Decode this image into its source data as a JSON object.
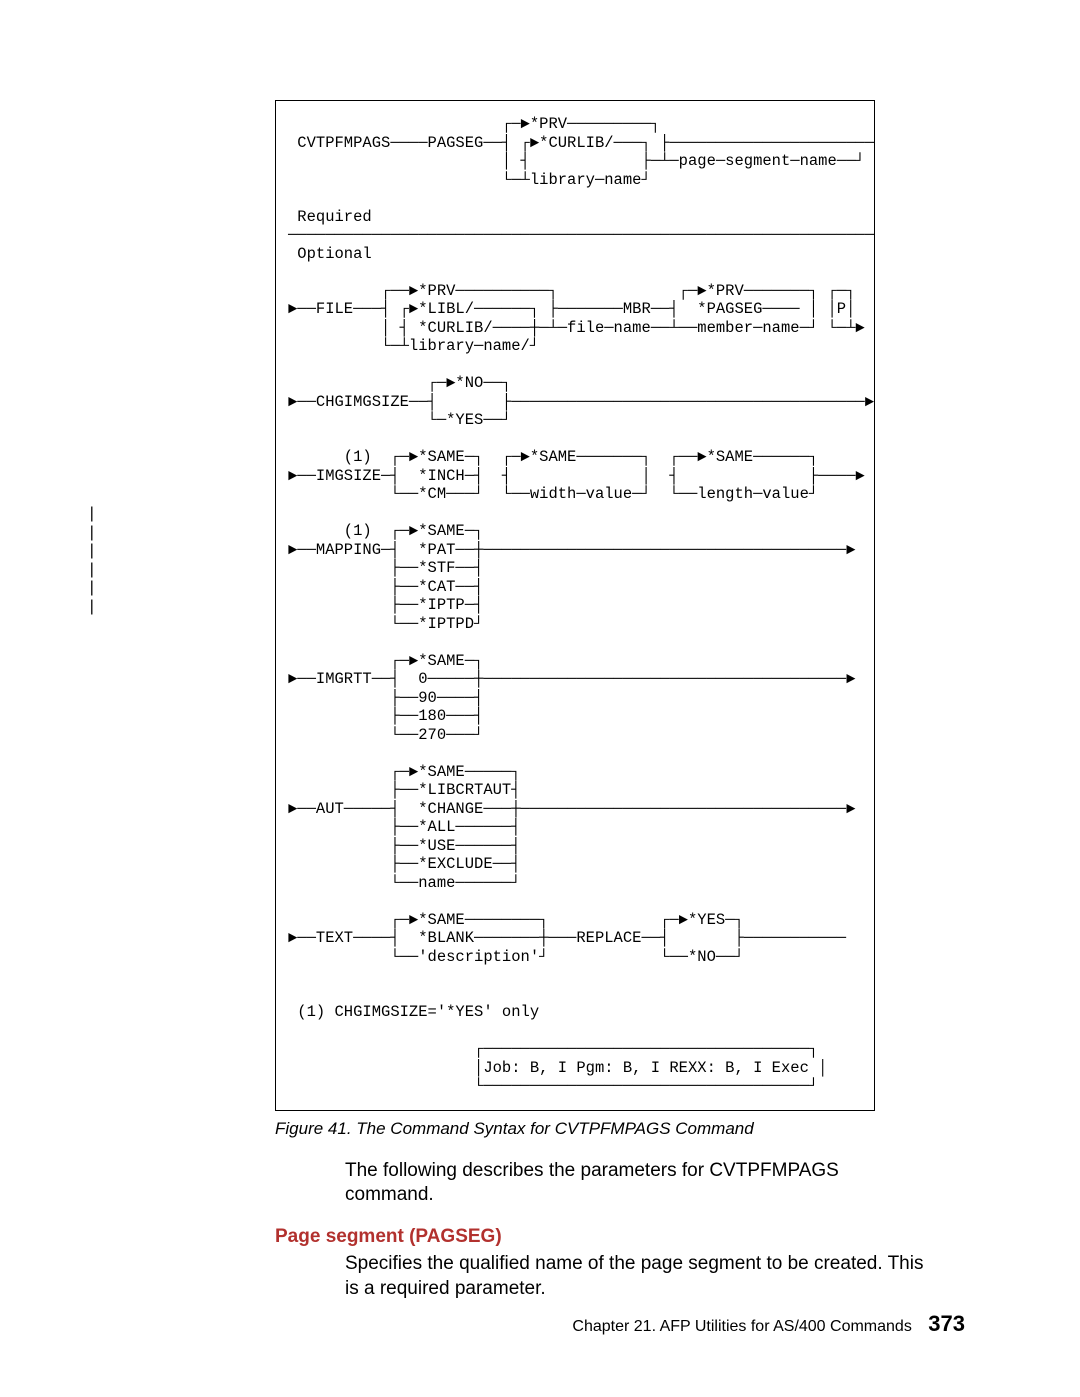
{
  "change_bars": "|\n|\n|\n|\n|\n|",
  "diagram_text": "                       ┌─►*PRV─────────┐\n CVTPFMPAGS────PAGSEG──┤ ┌►*CURLIB/───┐ ├──────────────────────►\n                       │ ┤            ├─┴─page─segment─name──┘\n                       └─┴library─name┘\n\n Required\n─────────────────────────────────────────────────────────────────\n Optional\n\n          ┌──►*PRV──────────┐             ┌─►*PRV───────┐ ┌─┐\n►──FILE───┤ ┌►*LIBL/──────┐ ├───────MBR──┤  *PAGSEG──── │ │P│\n          │ ┤ *CURLIB/────┼─┴─file─name──┴──member─name─┘ └─┴►\n          └─┴library─name/┘\n\n               ┌─►*NO──┐\n►──CHGIMGSIZE──┤       ├──────────────────────────────────────►\n               └─*YES──┘\n\n      (1)  ┌─►*SAME─┐  ┌─►*SAME───────┐  ┌──►*SAME──────┐\n►──IMGSIZE─┤  *INCH─┤  ┤              │  ┤              ├────►\n           └──*CM───┘  └──width─value─┘  └──length─value┘\n\n      (1)  ┌─►*SAME─┐\n►──MAPPING─┤  *PAT──┼───────────────────────────────────────►\n           ├──*STF──┤\n           ├──*CAT──┤\n           ├──*IPTP─┤\n           └──*IPTPD┘\n\n           ┌─►*SAME─┐\n►──IMGRTT──┤  0─────┼───────────────────────────────────────►\n           ├──90────┤\n           ├──180───┤\n           └──270───┘\n\n           ┌─►*SAME─────┐\n           ├──*LIBCRTAUT┤\n►──AUT─────┤  *CHANGE───┼───────────────────────────────────►\n           ├──*ALL──────┤\n           ├──*USE──────┤\n           ├──*EXCLUDE──┤\n           └──name──────┘\n\n           ┌─►*SAME────────┐            ┌─►*YES─┐\n►──TEXT────┤  *BLANK───────┼───REPLACE──┤       ├───────────\n           └──'description'┘            └──*NO──┘\n\n\n (1) CHGIMGSIZE='*YES' only\n\n                    ┌───────────────────────────────────┐\n                    │Job: B, I Pgm: B, I REXX: B, I Exec │\n                    └───────────────────────────────────┘",
  "caption_prefix": "Figure 41.",
  "caption_text": "The Command Syntax for CVTPFMPAGS Command",
  "intro_para": "The following describes the parameters for CVTPFMPAGS command.",
  "heading_pagseg": "Page segment (PAGSEG)",
  "pagseg_desc": "Specifies the qualified name of the page segment to be created.  This is a required parameter.",
  "footer_chapter": "Chapter 21.  AFP Utilities for AS/400 Commands",
  "footer_pagenum": "373"
}
